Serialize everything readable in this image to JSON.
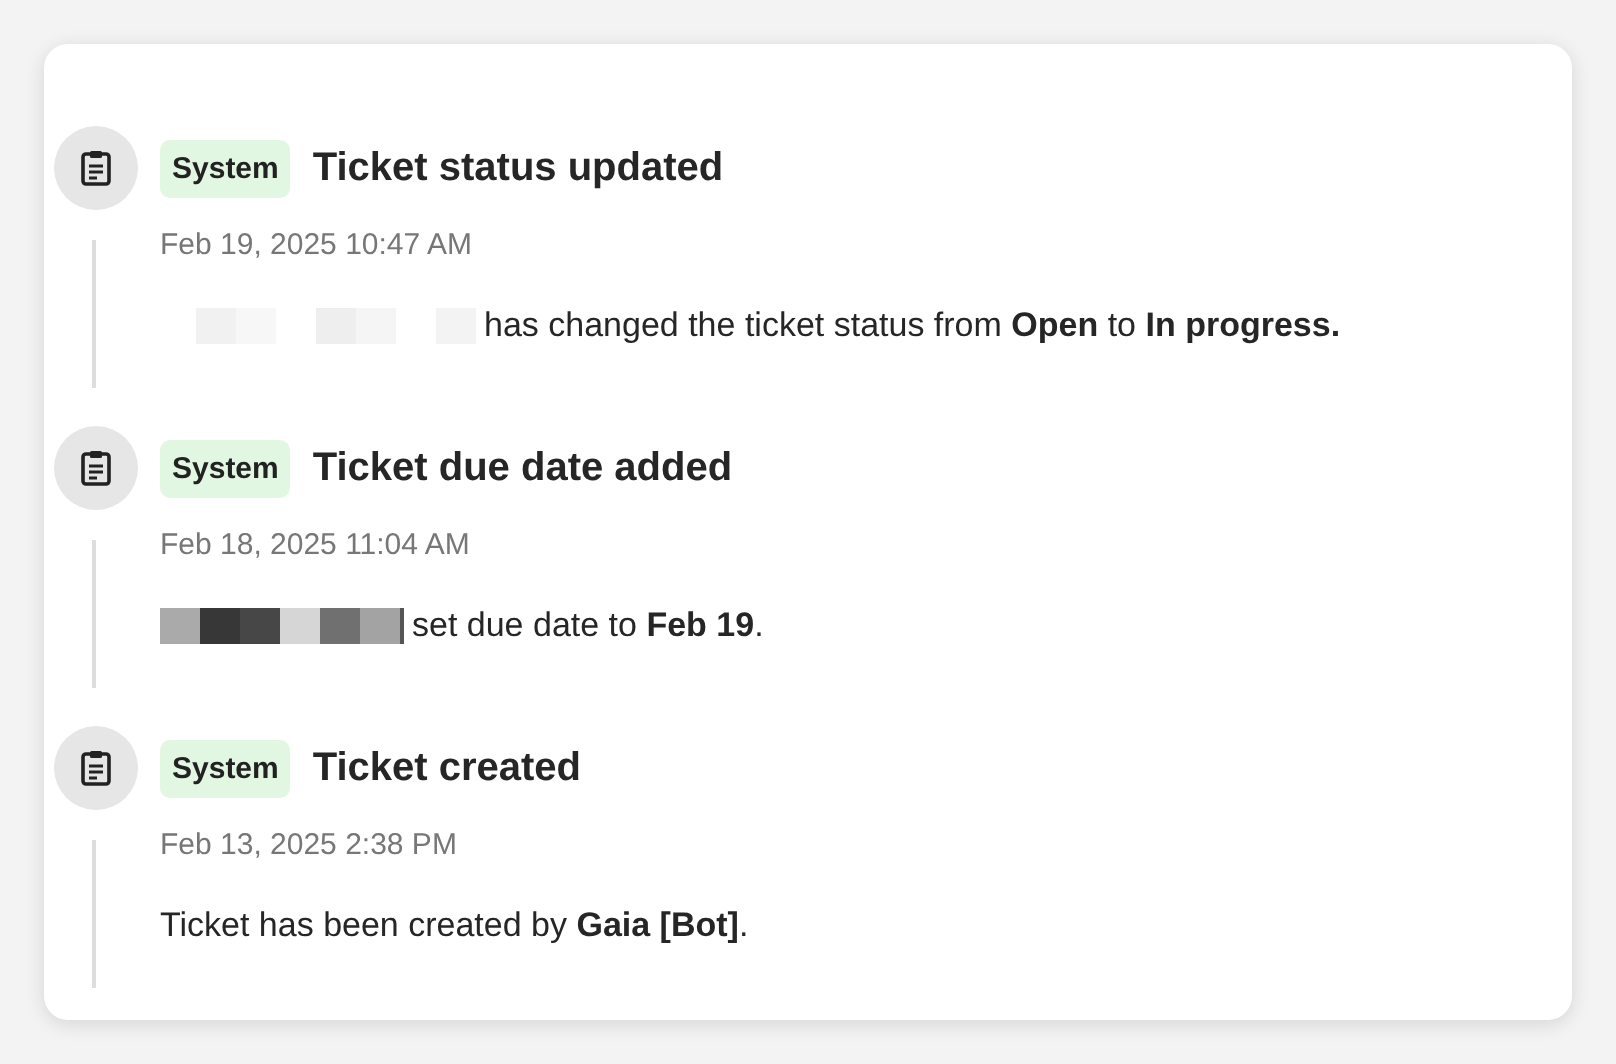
{
  "events": [
    {
      "badge": "System",
      "title": "Ticket status updated",
      "time": "Feb 19, 2025 10:47 AM",
      "kind": "faint",
      "text": "has changed the ticket status from **Open** to **In progress.**"
    },
    {
      "badge": "System",
      "title": "Ticket due date added",
      "time": "Feb 18, 2025 11:04 AM",
      "kind": "dark",
      "text": "set due date to **Feb 19**."
    },
    {
      "badge": "System",
      "title": "Ticket created",
      "time": "Feb 13, 2025 2:38 PM",
      "kind": "plain",
      "text": "Ticket has been created by **Gaia [Bot]**."
    }
  ]
}
